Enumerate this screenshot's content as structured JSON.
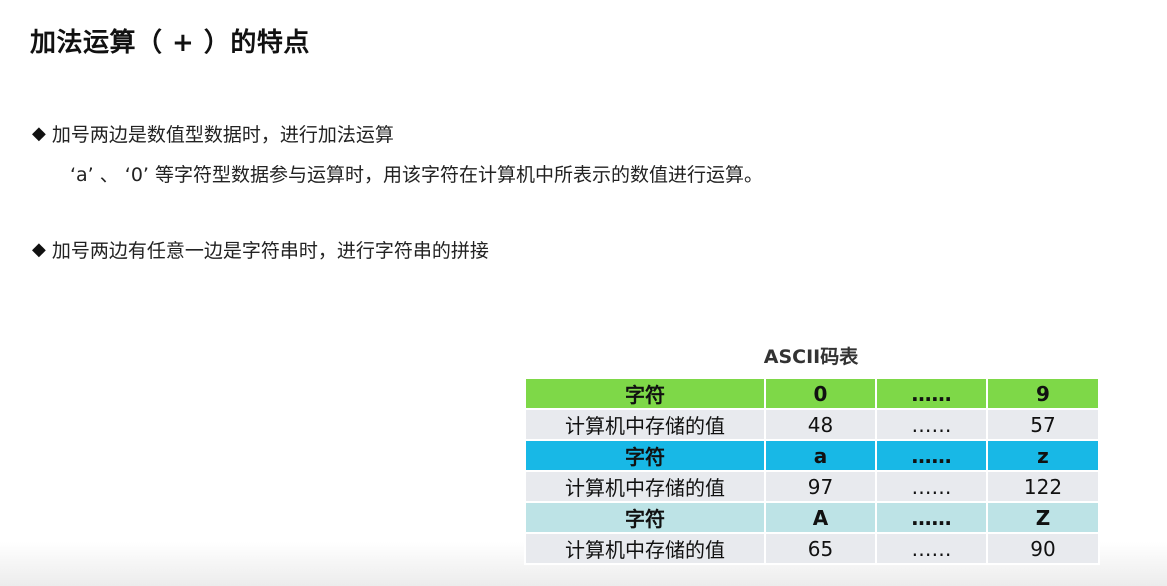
{
  "title": "加法运算（ + ）的特点",
  "bullets": [
    {
      "icon": "diamond-icon",
      "text": "加号两边是数值型数据时，进行加法运算",
      "subline": "‘a’  、 ‘0’ 等字符型数据参与运算时，用该字符在计算机中所表示的数值进行运算。"
    },
    {
      "icon": "diamond-icon",
      "text": "加号两边有任意一边是字符串时，进行字符串的拼接"
    }
  ],
  "table": {
    "title": "ASCII码表",
    "header_colors": [
      "#7ed848",
      "#18b8e6",
      "#bde3e6"
    ],
    "row_bg": "#e8eaee",
    "groups": [
      {
        "char_label": "字符",
        "chars": [
          "0",
          "……",
          "9"
        ],
        "value_label": "计算机中存储的值",
        "values": [
          "48",
          "……",
          "57"
        ]
      },
      {
        "char_label": "字符",
        "chars": [
          "a",
          "……",
          "z"
        ],
        "value_label": "计算机中存储的值",
        "values": [
          "97",
          "……",
          "122"
        ]
      },
      {
        "char_label": "字符",
        "chars": [
          "A",
          "……",
          "Z"
        ],
        "value_label": "计算机中存储的值",
        "values": [
          "65",
          "……",
          "90"
        ]
      }
    ]
  }
}
